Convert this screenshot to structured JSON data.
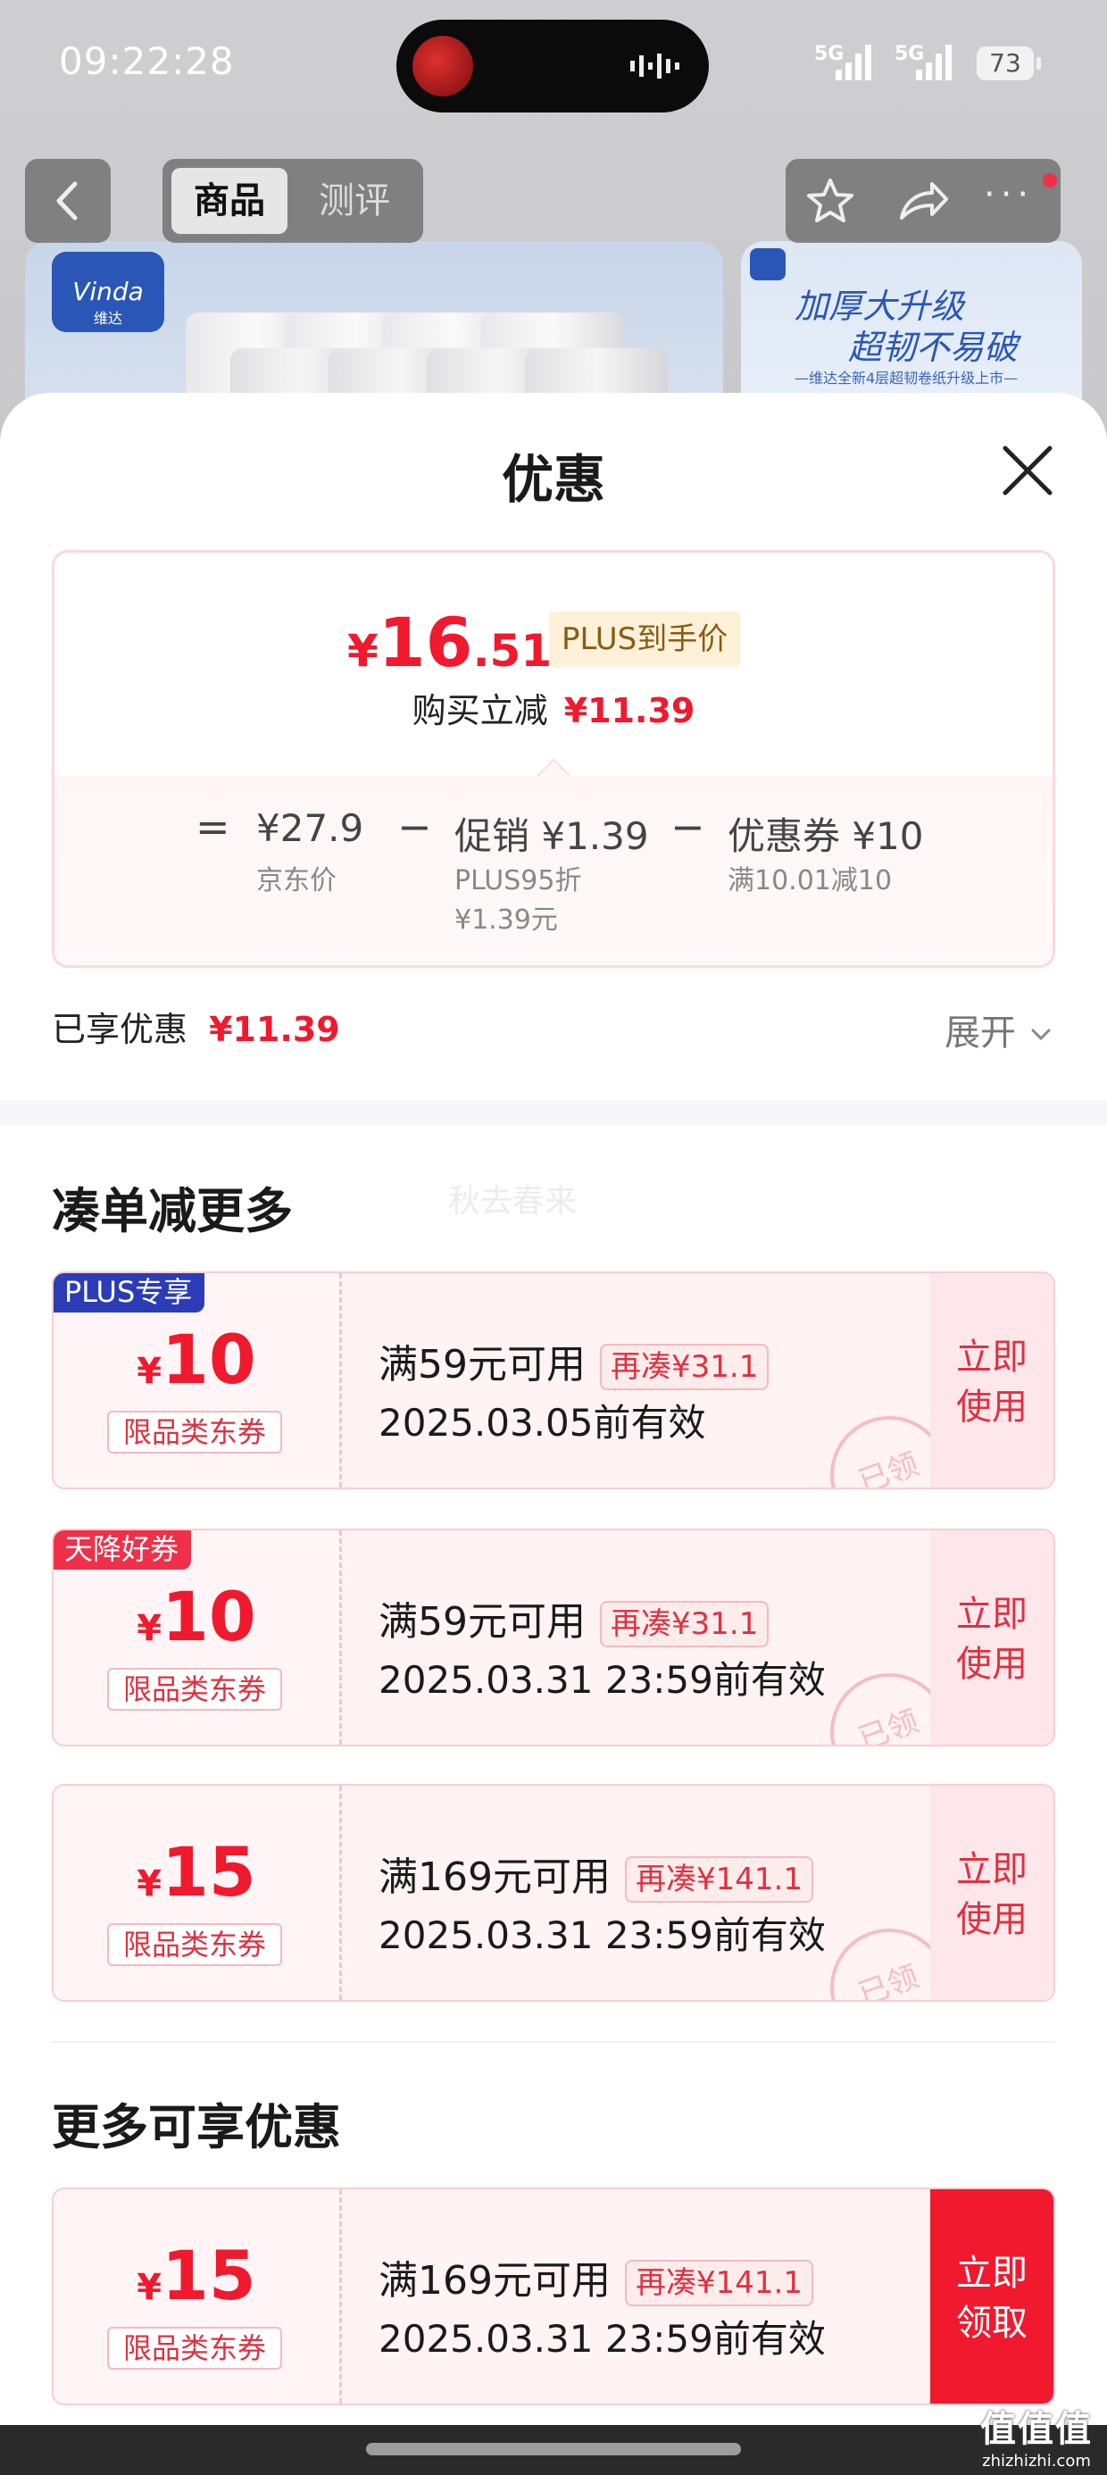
{
  "status_bar": {
    "time": "09:22:28",
    "network1": "5G",
    "network2": "5G",
    "battery": "73"
  },
  "nav": {
    "tab_active": "商品",
    "tab_other": "测评"
  },
  "product_image": {
    "brand": "Vinda",
    "brand_cn": "维达",
    "promo_line1": "加厚大升级",
    "promo_line2": "超韧不易破",
    "promo_sub": "—维达全新4层超韧卷纸升级上市—"
  },
  "sheet": {
    "title": "优惠"
  },
  "price_card": {
    "currency": "¥",
    "price_int": "16",
    "price_dec": ".51",
    "plus_tag": "PLUS到手价",
    "reduce_label": "购买立减",
    "reduce_value": "¥11.39",
    "eq": "=",
    "minus": "−",
    "base_value": "¥27.9",
    "base_label": "京东价",
    "promo_label": "促销 ¥1.39",
    "promo_sub1": "PLUS95折",
    "promo_sub2": "¥1.39元",
    "coupon_label": "优惠券 ¥10",
    "coupon_sub": "满10.01减10"
  },
  "enjoyed": {
    "label": "已享优惠",
    "value": "¥11.39",
    "expand": "展开"
  },
  "section1": {
    "title": "凑单减更多",
    "watermark": "秋去春来"
  },
  "coupons": [
    {
      "badge": "PLUS专享",
      "yen": "¥",
      "amount": "10",
      "limit": "限品类东券",
      "cond": "满59元可用",
      "gap": "再凑¥31.1",
      "date": "2025.03.05前有效",
      "action1": "立即",
      "action2": "使用",
      "stamp": "已领"
    },
    {
      "badge": "天降好券",
      "yen": "¥",
      "amount": "10",
      "limit": "限品类东券",
      "cond": "满59元可用",
      "gap": "再凑¥31.1",
      "date": "2025.03.31 23:59前有效",
      "action1": "立即",
      "action2": "使用",
      "stamp": "已领"
    },
    {
      "badge": "",
      "yen": "¥",
      "amount": "15",
      "limit": "限品类东券",
      "cond": "满169元可用",
      "gap": "再凑¥141.1",
      "date": "2025.03.31 23:59前有效",
      "action1": "立即",
      "action2": "使用",
      "stamp": "已领"
    }
  ],
  "section2": {
    "title": "更多可享优惠"
  },
  "more_coupon": {
    "yen": "¥",
    "amount": "15",
    "limit": "限品类东券",
    "cond": "满169元可用",
    "gap": "再凑¥141.1",
    "date": "2025.03.31 23:59前有效",
    "action1": "立即",
    "action2": "领取"
  },
  "watermark": {
    "logo": "值值值",
    "domain": "zhizhizhi.com"
  },
  "colors": {
    "accent": "#f0192e",
    "plus_badge": "#2b3cb6",
    "sky_badge": "#f0304a"
  }
}
